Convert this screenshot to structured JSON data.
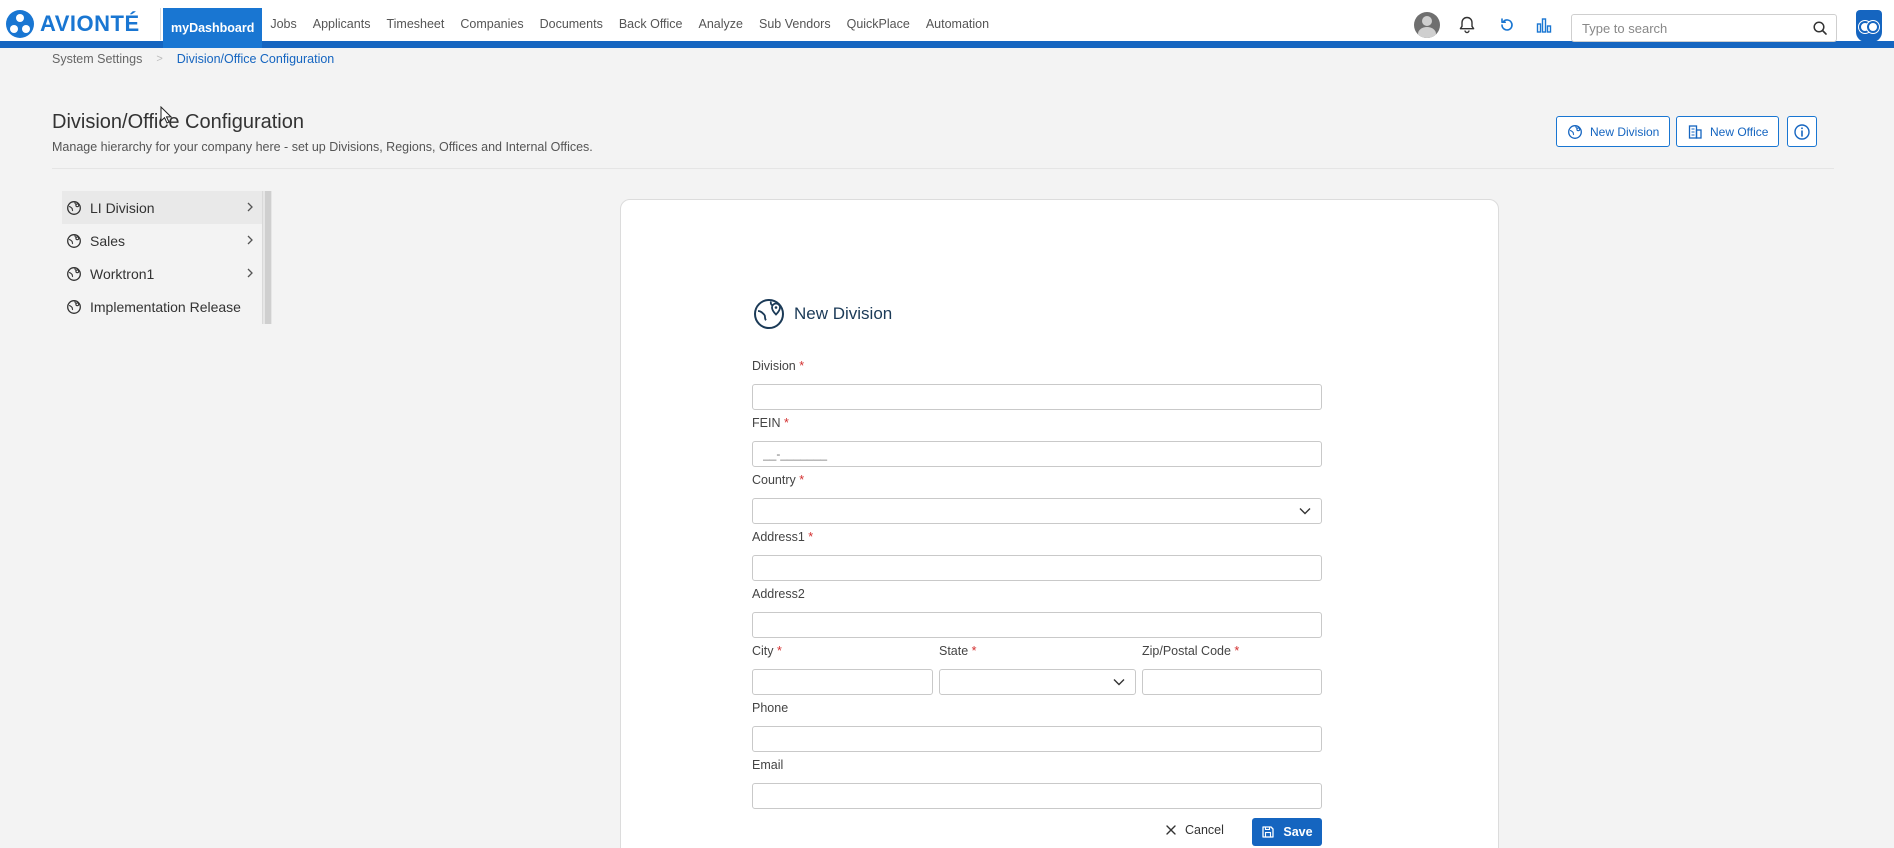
{
  "app": {
    "logo_text": "AVIONTÉ"
  },
  "nav": {
    "items": [
      "myDashboard",
      "Jobs",
      "Applicants",
      "Timesheet",
      "Companies",
      "Documents",
      "Back Office",
      "Analyze",
      "Sub Vendors",
      "QuickPlace",
      "Automation"
    ],
    "active_index": 0
  },
  "search": {
    "placeholder": "Type to search",
    "value": ""
  },
  "breadcrumb": {
    "parent": "System Settings",
    "current": "Division/Office Configuration"
  },
  "page": {
    "title": "Division/Office Configuration",
    "subtitle": "Manage hierarchy for your company here - set up Divisions, Regions, Offices and Internal Offices."
  },
  "actions": {
    "new_division": "New Division",
    "new_office": "New Office"
  },
  "tree": {
    "items": [
      {
        "label": "LI Division",
        "has_children": true,
        "selected": true
      },
      {
        "label": "Sales",
        "has_children": true,
        "selected": false
      },
      {
        "label": "Worktron1",
        "has_children": true,
        "selected": false
      },
      {
        "label": "Implementation Release",
        "has_children": false,
        "selected": false
      }
    ]
  },
  "form": {
    "title": "New Division",
    "fields": {
      "division": {
        "label": "Division",
        "required": "*",
        "value": ""
      },
      "fein": {
        "label": "FEIN",
        "required": "*",
        "placeholder": "__-_______",
        "value": ""
      },
      "country": {
        "label": "Country",
        "required": "*",
        "value": ""
      },
      "address1": {
        "label": "Address1",
        "required": "*",
        "value": ""
      },
      "address2": {
        "label": "Address2",
        "value": ""
      },
      "city": {
        "label": "City",
        "required": "*",
        "value": ""
      },
      "state": {
        "label": "State",
        "required": "*",
        "value": ""
      },
      "zip": {
        "label": "Zip/Postal Code",
        "required": "*",
        "value": ""
      },
      "phone": {
        "label": "Phone",
        "value": ""
      },
      "email": {
        "label": "Email",
        "value": ""
      }
    },
    "cancel_label": "Cancel",
    "save_label": "Save"
  },
  "colors": {
    "brand": "#1565c0",
    "accent": "#1976d2",
    "required": "#d32f2f"
  }
}
